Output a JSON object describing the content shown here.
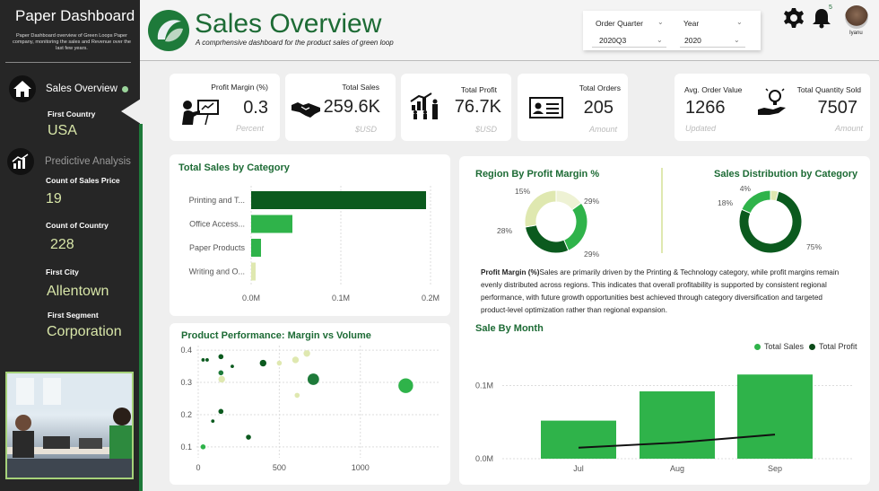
{
  "sidebar": {
    "title": "Paper Dashboard",
    "subtitle": "Paper Dashboard overview of Green Loops Paper company, monitoring the sales and Revenue over the last few years.",
    "nav": [
      {
        "label": "Sales Overview",
        "icon": "home-icon"
      },
      {
        "label": "Predictive Analysis",
        "icon": "chart-icon"
      }
    ],
    "stats": [
      {
        "label": "First Country",
        "value": "USA"
      },
      {
        "label": "Count of Sales Price",
        "value": "19"
      },
      {
        "label": "Count of Country",
        "value": "228"
      },
      {
        "label": "First City",
        "value": "Allentown"
      },
      {
        "label": "First Segment",
        "value": "Corporation"
      }
    ]
  },
  "header": {
    "title": "Sales Overview",
    "subtitle": "A comprhensive dashboard for the product sales of green loop",
    "filters": [
      {
        "label": "Order Quarter",
        "value": "2020Q3"
      },
      {
        "label": "Year",
        "value": "2020"
      }
    ],
    "notification_count": "5",
    "user_name": "Iyanu"
  },
  "kpis": [
    {
      "label": "Profit Margin (%)",
      "value": "0.3",
      "unit": "Percent",
      "icon": "presenter-icon"
    },
    {
      "label": "Total Sales",
      "value": "259.6K",
      "unit": "$USD",
      "icon": "handshake-icon"
    },
    {
      "label": "Total Profit",
      "value": "76.7K",
      "unit": "$USD",
      "icon": "growth-people-icon"
    },
    {
      "label": "Total Orders",
      "value": "205",
      "unit": "Amount",
      "icon": "id-card-icon"
    },
    {
      "label": "Avg. Order Value",
      "value": "1266",
      "unit": "Updated",
      "icon": ""
    },
    {
      "label": "Total Quantity Sold",
      "value": "7507",
      "unit": "Amount",
      "icon": "idea-hand-icon"
    }
  ],
  "sections": {
    "sales_by_category": "Total Sales by Category",
    "product_performance": "Product Performance: Margin vs Volume",
    "region_margin": "Region By Profit Margin %",
    "sales_distribution": "Sales Distribution by Category",
    "sale_by_month": "Sale By Month"
  },
  "insight": {
    "bold": "Profit Margin (%)",
    "text": "Sales are primarily driven by the Printing & Technology category, while profit margins remain evenly distributed across regions. This indicates that overall profitability is supported by consistent regional performance, with future growth opportunities best achieved through category diversification and targeted product-level optimization rather than regional expansion."
  },
  "colors": {
    "dark_green": "#0b5a1e",
    "green": "#2fb34a",
    "light_green": "#dfe8b0",
    "brand": "#1d6b35"
  },
  "chart_data": [
    {
      "type": "bar",
      "orientation": "horizontal",
      "title": "Total Sales by Category",
      "categories": [
        "Printing and T...",
        "Office Access...",
        "Paper Products",
        "Writing and O..."
      ],
      "values": [
        195000,
        46000,
        11000,
        5000
      ],
      "colors": [
        "#0b5a1e",
        "#2fb34a",
        "#2fb34a",
        "#dfe8b0"
      ],
      "xlim": [
        0,
        200000
      ],
      "xticks": [
        "0.0M",
        "0.1M",
        "0.2M"
      ]
    },
    {
      "type": "scatter",
      "title": "Product Performance: Margin vs Volume",
      "xlim": [
        0,
        1300
      ],
      "ylim": [
        0.08,
        0.42
      ],
      "xticks": [
        0,
        500,
        1000
      ],
      "yticks": [
        0.1,
        0.2,
        0.3,
        0.4
      ],
      "points": [
        {
          "x": 30,
          "y": 0.37,
          "s": 1,
          "c": "#0b5a1e"
        },
        {
          "x": 55,
          "y": 0.37,
          "s": 1,
          "c": "#0b5a1e"
        },
        {
          "x": 140,
          "y": 0.38,
          "s": 2,
          "c": "#0b5a1e"
        },
        {
          "x": 140,
          "y": 0.33,
          "s": 2,
          "c": "#1e7a3a"
        },
        {
          "x": 145,
          "y": 0.31,
          "s": 3,
          "c": "#dfe8b0"
        },
        {
          "x": 210,
          "y": 0.35,
          "s": 1,
          "c": "#0b5a1e"
        },
        {
          "x": 400,
          "y": 0.36,
          "s": 3,
          "c": "#0b5a1e"
        },
        {
          "x": 500,
          "y": 0.36,
          "s": 2,
          "c": "#dfe8b0"
        },
        {
          "x": 600,
          "y": 0.37,
          "s": 3,
          "c": "#dfe8b0"
        },
        {
          "x": 670,
          "y": 0.39,
          "s": 3,
          "c": "#dfe8b0"
        },
        {
          "x": 710,
          "y": 0.31,
          "s": 6,
          "c": "#1e7a3a"
        },
        {
          "x": 610,
          "y": 0.26,
          "s": 2,
          "c": "#dfe8b0"
        },
        {
          "x": 140,
          "y": 0.21,
          "s": 2,
          "c": "#0b5a1e"
        },
        {
          "x": 90,
          "y": 0.18,
          "s": 1,
          "c": "#0b5a1e"
        },
        {
          "x": 310,
          "y": 0.13,
          "s": 2,
          "c": "#0b5a1e"
        },
        {
          "x": 30,
          "y": 0.1,
          "s": 2,
          "c": "#2fb34a"
        },
        {
          "x": 1280,
          "y": 0.29,
          "s": 8,
          "c": "#2fb34a"
        }
      ]
    },
    {
      "type": "pie",
      "subtype": "donut",
      "title": "Region By Profit Margin %",
      "labels": [
        "15%",
        "29%",
        "29%",
        "28%"
      ],
      "values": [
        15,
        29,
        29,
        28
      ],
      "colors": [
        "#eef2d4",
        "#2fb34a",
        "#0b5a1e",
        "#dfe8b0"
      ]
    },
    {
      "type": "pie",
      "subtype": "donut",
      "title": "Sales Distribution by Category",
      "labels": [
        "4%",
        "75%",
        "18%"
      ],
      "values": [
        4,
        75,
        18
      ],
      "colors": [
        "#dfe8b0",
        "#0b5a1e",
        "#2fb34a"
      ]
    },
    {
      "type": "bar",
      "title": "Sale By Month",
      "categories": [
        "Jul",
        "Aug",
        "Sep"
      ],
      "series": [
        {
          "name": "Total Sales",
          "type": "bar",
          "values": [
            52000,
            92000,
            115000
          ],
          "color": "#2fb34a"
        },
        {
          "name": "Total Profit",
          "type": "line",
          "values": [
            15000,
            22000,
            33000
          ],
          "color": "#111"
        }
      ],
      "ylim": [
        0,
        130000
      ],
      "yticks": [
        "0.0M",
        "0.1M"
      ],
      "legend": "top-right"
    }
  ]
}
